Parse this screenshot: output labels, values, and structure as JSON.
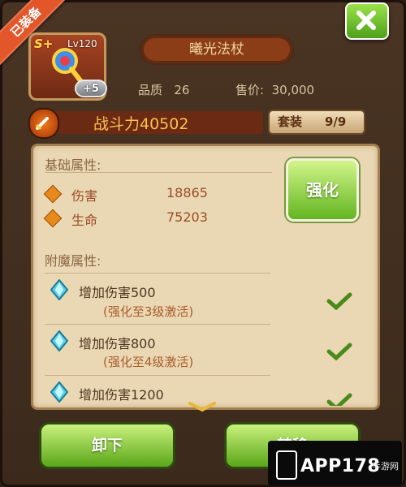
{
  "ribbon": {
    "label": "已装备"
  },
  "item": {
    "grade": "S+",
    "level": "Lv120",
    "enhance": "+5",
    "name": "曦光法杖",
    "quality_label": "品质",
    "quality_value": "26",
    "price_label": "售价:",
    "price_value": "30,000"
  },
  "power": {
    "text": "战斗力40502"
  },
  "set": {
    "label": "套装",
    "value": "9/9"
  },
  "base": {
    "title": "基础属性:",
    "stats": [
      {
        "name": "伤害",
        "value": "18865"
      },
      {
        "name": "生命",
        "value": "75203"
      }
    ]
  },
  "upgrade_label": "强化",
  "enchant": {
    "title": "附魔属性:",
    "items": [
      {
        "text": "增加伤害500",
        "sub": "(强化至3级激活)"
      },
      {
        "text": "增加伤害800",
        "sub": "(强化至4级激活)"
      },
      {
        "text": "增加伤害1200",
        "sub": ""
      }
    ]
  },
  "buttons": {
    "unequip": "卸下",
    "transfer": "转移"
  },
  "watermark": {
    "main": "APP178",
    "sub": "手游网"
  },
  "colors": {
    "accent_green": "#63b520",
    "title_orange": "#ffbf4a",
    "ribbon": "#e2562a"
  },
  "icons": [
    "close-icon",
    "staff-icon",
    "sword-icon",
    "diamond-icon",
    "gem-icon",
    "check-icon",
    "chevron-down-icon",
    "phone-icon"
  ]
}
